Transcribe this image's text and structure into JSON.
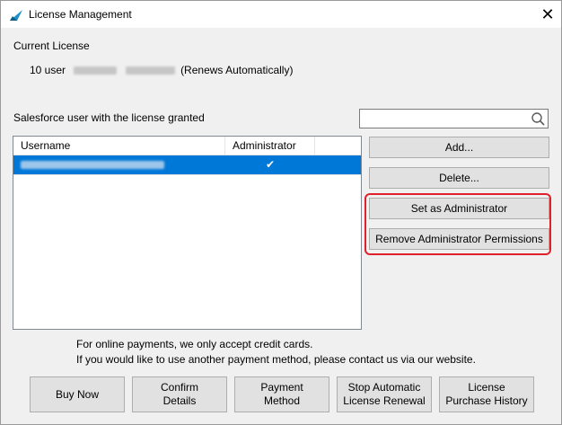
{
  "window": {
    "title": "License Management",
    "close_glyph": "✕"
  },
  "current_license": {
    "heading": "Current License",
    "prefix": "10 user",
    "suffix": "(Renews Automatically)"
  },
  "users_section": {
    "heading": "Salesforce user with the license granted"
  },
  "search": {
    "value": "",
    "placeholder": ""
  },
  "table": {
    "columns": [
      "Username",
      "Administrator"
    ],
    "rows": [
      {
        "username": "",
        "administrator": "✔"
      }
    ]
  },
  "side_buttons": {
    "add": "Add...",
    "delete": "Delete...",
    "set_admin": "Set as Administrator",
    "remove_admin": "Remove Administrator Permissions"
  },
  "notice": {
    "line1": "For online payments, we only accept credit cards.",
    "line2": "If you would like to use another payment method, please contact us via our website."
  },
  "bottom_buttons": {
    "buy_now": "Buy Now",
    "confirm_details": "Confirm\nDetails",
    "payment_method": "Payment\nMethod",
    "stop_renewal": "Stop  Automatic\nLicense Renewal",
    "purchase_history": "License\nPurchase History"
  },
  "colors": {
    "selection": "#0078d7",
    "highlight_border": "#e0202a",
    "button_face": "#e1e1e1"
  }
}
